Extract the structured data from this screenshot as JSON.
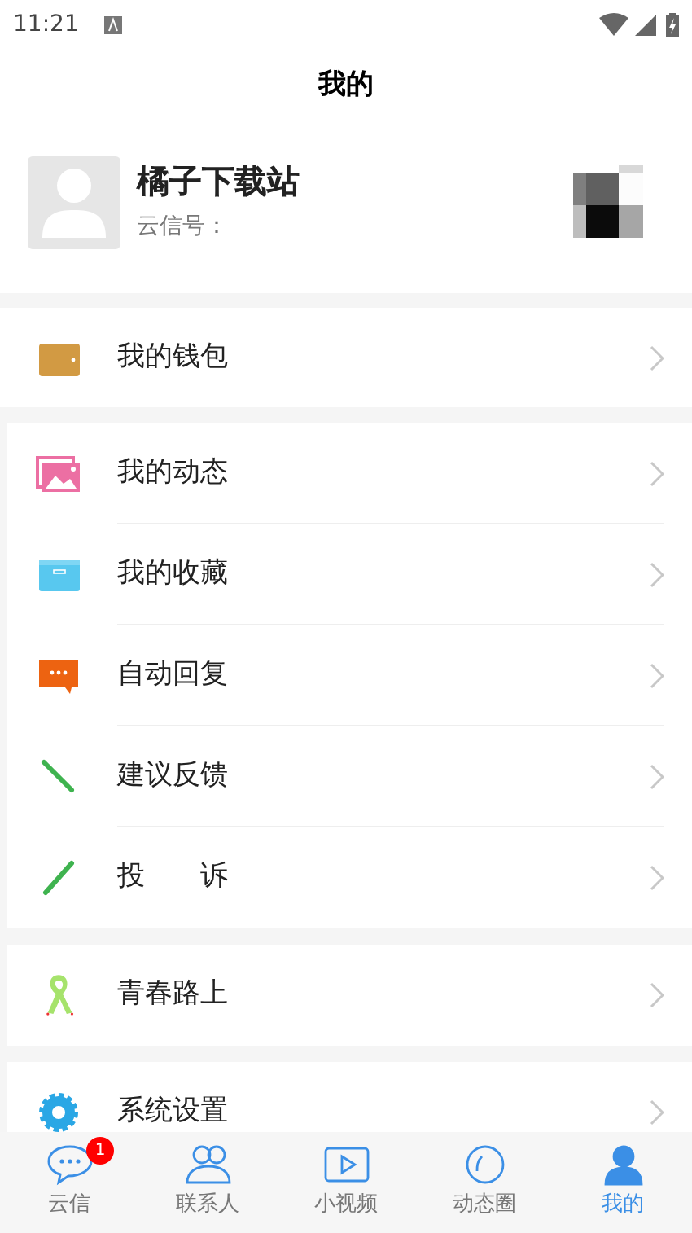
{
  "status_bar": {
    "time": "11:21"
  },
  "title": "我的",
  "profile": {
    "name": "橘子下载站",
    "id_label": "云信号："
  },
  "menu_groups": [
    [
      {
        "kind": "wallet",
        "label": "我的钱包"
      }
    ],
    [
      {
        "kind": "moments",
        "label": "我的动态"
      },
      {
        "kind": "favorites",
        "label": "我的收藏"
      },
      {
        "kind": "auto_reply",
        "label": "自动回复"
      },
      {
        "kind": "feedback",
        "label": "建议反馈"
      },
      {
        "kind": "complaint",
        "label": "投　　诉"
      }
    ],
    [
      {
        "kind": "youth",
        "label": "青春路上"
      }
    ],
    [
      {
        "kind": "settings",
        "label": "系统设置"
      }
    ]
  ],
  "tabs": [
    {
      "kind": "chat",
      "label": "云信",
      "selected": false,
      "badge": "1"
    },
    {
      "kind": "contacts",
      "label": "联系人",
      "selected": false
    },
    {
      "kind": "video",
      "label": "小视频",
      "selected": false
    },
    {
      "kind": "circle",
      "label": "动态圈",
      "selected": false
    },
    {
      "kind": "me",
      "label": "我的",
      "selected": true
    }
  ]
}
